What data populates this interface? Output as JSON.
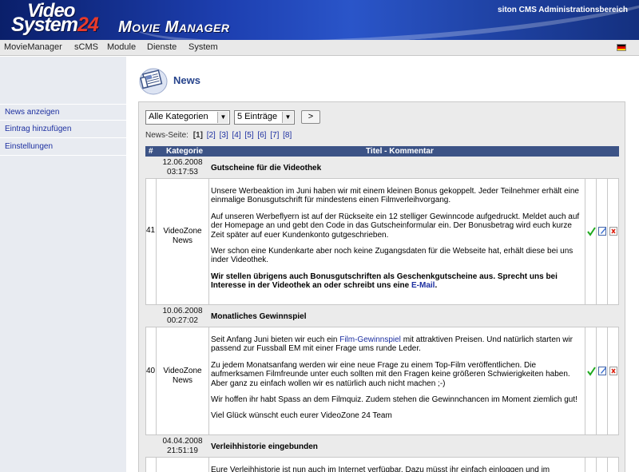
{
  "header": {
    "logo_line1": "Video",
    "logo_line2_text": "System",
    "logo_line2_num": "24",
    "app_title": "Movie Manager",
    "admin_label": "siton CMS Administrationsbereich"
  },
  "menu": [
    "MovieManager",
    "sCMS",
    "Module",
    "Dienste",
    "System"
  ],
  "sidebar": {
    "items": [
      "News anzeigen",
      "Eintrag hinzufügen",
      "Einstellungen"
    ]
  },
  "page": {
    "title": "News"
  },
  "filters": {
    "category_selected": "Alle Kategorien",
    "count_selected": "5 Einträge",
    "go_label": ">"
  },
  "pager": {
    "label": "News-Seite:",
    "current": "[1]",
    "pages": [
      "[2]",
      "[3]",
      "[4]",
      "[5]",
      "[6]",
      "[7]",
      "[8]"
    ]
  },
  "table": {
    "headers": {
      "id": "#",
      "category": "Kategorie",
      "title": "Titel - Kommentar"
    },
    "rows": [
      {
        "id": "41",
        "date": "12.06.2008",
        "time": "03:17:53",
        "category_l1": "VideoZone",
        "category_l2": "News",
        "title": "Gutscheine für die Videothek",
        "p1": "Unsere Werbeaktion im Juni haben wir mit einem kleinen Bonus gekoppelt. Jeder Teilnehmer erhält eine einmalige Bonusgutschrift für mindestens einen Filmverleihvorgang.",
        "p2": "Auf unseren Werbeflyern ist auf der Rückseite ein 12 stelliger Gewinncode aufgedruckt. Meldet auch auf der Homepage an und gebt den Code in das Gutscheinformular ein. Der Bonusbetrag wird euch kurze Zeit später auf euer Kundenkonto gutgeschrieben.",
        "p3": "Wer schon eine Kundenkarte aber noch keine Zugangsdaten für die Webseite hat, erhält diese bei uns inder Videothek.",
        "p4_bold": "Wir stellen übrigens auch Bonusgutschriften als Geschenkgutscheine aus. Sprecht uns bei Interesse in der Videothek an oder schreibt uns eine",
        "p4_link": "E-Mail",
        "p4_end": "."
      },
      {
        "id": "40",
        "date": "10.06.2008",
        "time": "00:27:02",
        "category_l1": "VideoZone",
        "category_l2": "News",
        "title": "Monatliches Gewinnspiel",
        "p1_a": "Seit Anfang Juni bieten wir euch ein",
        "p1_link": "Film-Gewinnspiel",
        "p1_b": "mit attraktiven Preisen. Und natürlich starten wir passend zur Fussball EM mit einer Frage ums runde Leder.",
        "p2": "Zu jedem Monatsanfang werden wir eine neue Frage zu einem Top-Film veröffentlichen. Die aufmerksamen Filmfreunde unter euch sollten mit den Fragen keine größeren Schwierigkeiten haben. Aber ganz zu einfach wollen wir es natürlich auch nicht machen ;-)",
        "p3": "Wir hoffen ihr habt Spass an dem Filmquiz. Zudem stehen die Gewinnchancen im Moment ziemlich gut!",
        "p4": "Viel Glück wünscht euch eurer VideoZone 24 Team"
      },
      {
        "date": "04.04.2008",
        "time": "21:51:19",
        "title": "Verleihhistorie eingebunden",
        "p1": "Eure Verleihhistorie ist nun auch im Internet verfügbar. Dazu müsst ihr einfach einloggen und im"
      }
    ]
  },
  "colors": {
    "accent": "#3c5386",
    "link": "#1c2fa0",
    "check": "#1faa1f"
  }
}
